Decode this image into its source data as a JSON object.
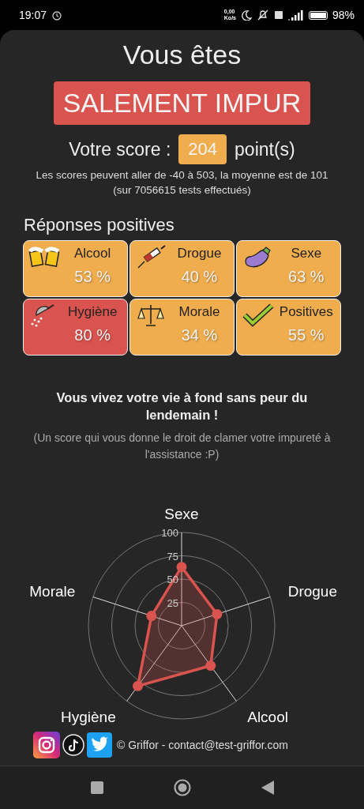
{
  "status_bar": {
    "time": "19:07",
    "net_speed": "0,00",
    "net_unit": "Ko/s",
    "battery": "98%"
  },
  "result": {
    "heading": "Vous êtes",
    "verdict": "SALEMENT IMPUR",
    "score_label": "Votre score :",
    "score": "204",
    "score_unit": "point(s)",
    "range_note": "Les scores peuvent aller de -40 à 503, la moyenne est de 101",
    "tests_note": "(sur 7056615 tests effectués)"
  },
  "positives": {
    "title": "Réponses positives",
    "tiles": [
      {
        "kind": "beer",
        "label": "Alcool",
        "value": "53 %",
        "color": "#f0ad4e"
      },
      {
        "kind": "syringe",
        "label": "Drogue",
        "value": "40 %",
        "color": "#f0ad4e"
      },
      {
        "kind": "eggplant",
        "label": "Sexe",
        "value": "63 %",
        "color": "#f0ad4e"
      },
      {
        "kind": "shower",
        "label": "Hygiène",
        "value": "80 %",
        "color": "#d9534f"
      },
      {
        "kind": "scales",
        "label": "Morale",
        "value": "34 %",
        "color": "#f0ad4e"
      },
      {
        "kind": "check",
        "label": "Positives",
        "value": "55 %",
        "color": "#f0ad4e"
      }
    ]
  },
  "comment": {
    "headline": "Vous vivez votre vie à fond sans peur du lendemain !",
    "note": "(Un score qui vous donne le droit de clamer votre impureté à l'assistance :P)"
  },
  "radar": {
    "chart_data": {
      "type": "radar",
      "categories": [
        "Sexe",
        "Drogue",
        "Alcool",
        "Hygiène",
        "Morale"
      ],
      "series": [
        {
          "color": "#d9534f",
          "values": [
            63,
            40,
            53,
            80,
            34
          ]
        }
      ],
      "ylim": [
        0,
        100
      ],
      "yticks": [
        25,
        50,
        75,
        100
      ]
    }
  },
  "footer": {
    "copyright": "© Griffor - contact@test-griffor.com"
  }
}
